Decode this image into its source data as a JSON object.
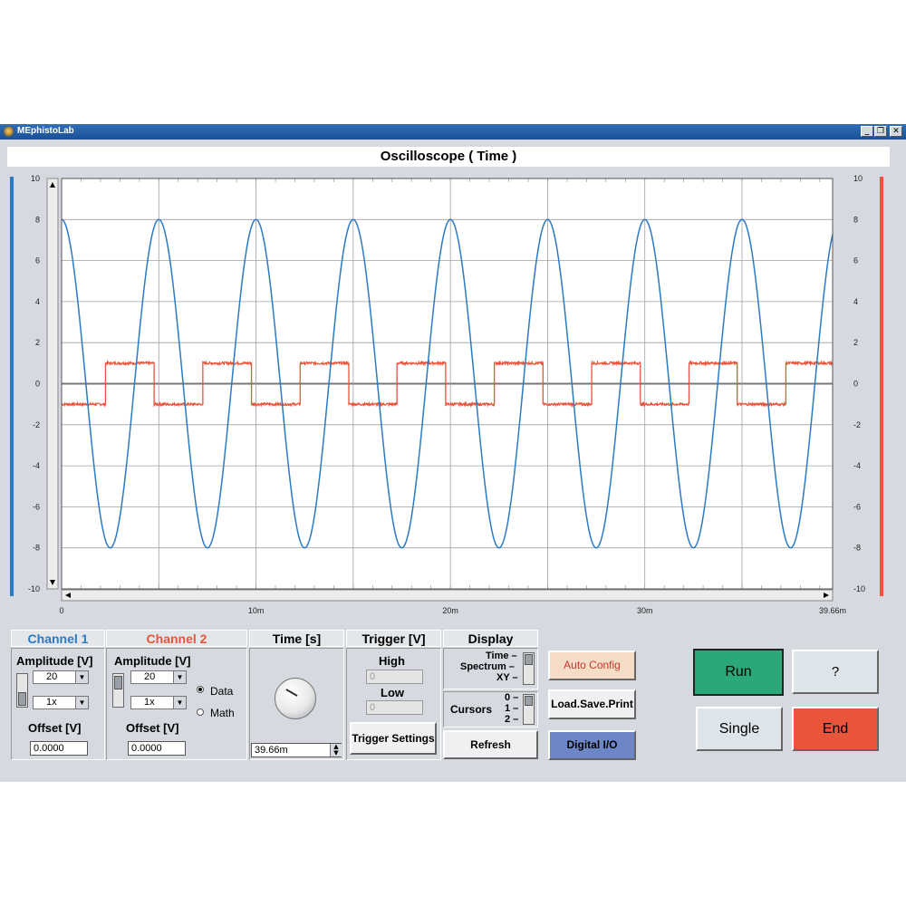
{
  "window": {
    "title": "MEphistoLab",
    "minimize": "_",
    "restore": "❐",
    "close": "✕"
  },
  "scope": {
    "title": "Oscilloscope ( Time )",
    "y_ticks": [
      "10",
      "8",
      "6",
      "4",
      "2",
      "0",
      "-2",
      "-4",
      "-6",
      "-8",
      "-10"
    ],
    "x_ticks": [
      "0",
      "10m",
      "20m",
      "30m",
      "39.66m"
    ],
    "colors": {
      "channel1": "#2a7ac4",
      "channel2": "#e8553a",
      "grid": "#808080"
    }
  },
  "chart_data": {
    "type": "line",
    "x_range": [
      0,
      0.03966
    ],
    "ylim": [
      -10,
      10
    ],
    "grid": true,
    "series": [
      {
        "name": "Channel 1",
        "color": "#2a7ac4",
        "amplitude": 8,
        "period": 0.005,
        "first_peak_time": 0.005,
        "shape": "sine"
      },
      {
        "name": "Channel 2",
        "color": "#e8553a",
        "amplitude": 1,
        "period": 0.005,
        "high_start_time": 0.00225,
        "shape": "square"
      }
    ]
  },
  "controls": {
    "channel1": {
      "header": "Channel 1",
      "amplitude_label": "Amplitude [V]",
      "amplitude_value": "20",
      "probe_value": "1x",
      "offset_label": "Offset [V]",
      "offset_value": "0.0000"
    },
    "channel2": {
      "header": "Channel 2",
      "amplitude_label": "Amplitude [V]",
      "amplitude_value": "20",
      "probe_value": "1x",
      "offset_label": "Offset [V]",
      "offset_value": "0.0000",
      "data_option": "Data",
      "math_option": "Math"
    },
    "time": {
      "header": "Time [s]",
      "value": "39.66m"
    },
    "trigger": {
      "header": "Trigger [V]",
      "high_label": "High",
      "high_value": "0",
      "low_label": "Low",
      "low_value": "0",
      "settings_button": "Trigger Settings"
    },
    "display": {
      "header": "Display",
      "mode_time": "Time –",
      "mode_spectrum": "Spectrum –",
      "mode_xy": "XY –",
      "cursors_label": "Cursors",
      "cursor_0": "0 –",
      "cursor_1": "1 –",
      "cursor_2": "2 –",
      "refresh_button": "Refresh"
    },
    "buttons": {
      "auto_config": "Auto Config",
      "load_save_print": "Load.Save.Print",
      "digital_io": "Digital I/O",
      "run": "Run",
      "help": "?",
      "single": "Single",
      "end": "End"
    }
  }
}
